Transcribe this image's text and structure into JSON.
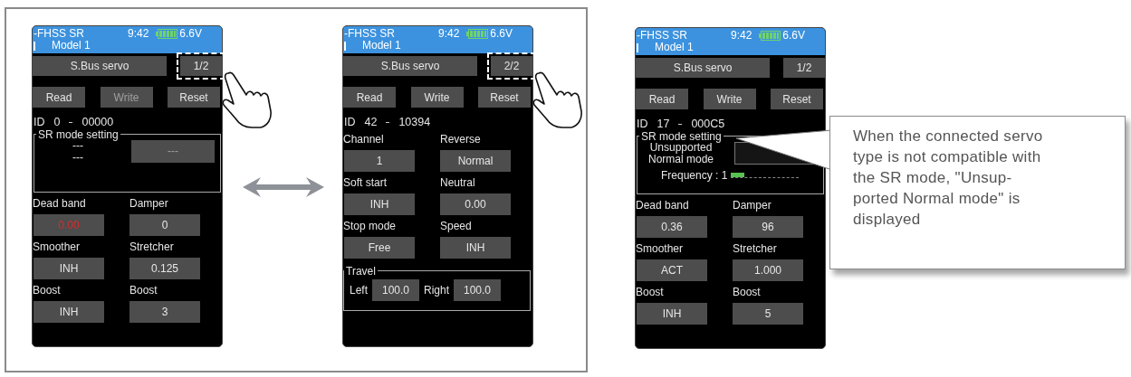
{
  "left_panel": {
    "screens": [
      {
        "header": {
          "system": "-FHSS SR",
          "time": "9:42",
          "voltage": "6.6V",
          "model": "Model 1"
        },
        "title_button": "S.Bus servo",
        "page_button": {
          "label": "1/2",
          "highlighted": true
        },
        "hand": true,
        "actions": [
          {
            "label": "Read",
            "disabled": false
          },
          {
            "label": "Write",
            "disabled": true
          },
          {
            "label": "Reset",
            "disabled": false
          }
        ],
        "id_line": {
          "label": "ID",
          "number": "0",
          "code": "00000"
        },
        "blocks": [
          {
            "kind": "group",
            "title": "SR mode setting",
            "lines": [
              "---",
              "---"
            ],
            "field": {
              "text": "---",
              "disabled": true
            }
          },
          {
            "kind": "params",
            "items": [
              {
                "label": "Dead band",
                "value": "0.00",
                "alert": true
              },
              {
                "label": "Damper",
                "value": "0",
                "alert": false
              }
            ]
          },
          {
            "kind": "params",
            "items": [
              {
                "label": "Smoother",
                "value": "INH",
                "alert": false
              },
              {
                "label": "Stretcher",
                "value": "0.125",
                "alert": false
              }
            ]
          },
          {
            "kind": "params",
            "items": [
              {
                "label": "Boost",
                "value": "INH",
                "alert": false
              },
              {
                "label": "Boost",
                "value": "3",
                "alert": false
              }
            ]
          }
        ]
      },
      {
        "header": {
          "system": "-FHSS SR",
          "time": "9:42",
          "voltage": "6.6V",
          "model": "Model 1"
        },
        "title_button": "S.Bus servo",
        "page_button": {
          "label": "2/2",
          "highlighted": true
        },
        "hand": true,
        "actions": [
          {
            "label": "Read",
            "disabled": false
          },
          {
            "label": "Write",
            "disabled": false
          },
          {
            "label": "Reset",
            "disabled": false
          }
        ],
        "id_line": {
          "label": "ID",
          "number": "42",
          "code": "10394"
        },
        "blocks": [
          {
            "kind": "params",
            "items": [
              {
                "label": "Channel",
                "value": "1",
                "alert": false
              },
              {
                "label": "Reverse",
                "value": "Normal",
                "alert": false
              }
            ]
          },
          {
            "kind": "params",
            "items": [
              {
                "label": "Soft start",
                "value": "INH",
                "alert": false
              },
              {
                "label": "Neutral",
                "value": "0.00",
                "alert": false
              }
            ]
          },
          {
            "kind": "params",
            "items": [
              {
                "label": "Stop mode",
                "value": "Free",
                "alert": false
              },
              {
                "label": "Speed",
                "value": "INH",
                "alert": false
              }
            ]
          },
          {
            "kind": "travel",
            "title": "Travel",
            "items": [
              {
                "label": "Left",
                "value": "100.0"
              },
              {
                "label": "Right",
                "value": "100.0"
              }
            ]
          }
        ]
      }
    ]
  },
  "right_panel": {
    "screens": [
      {
        "header": {
          "system": "-FHSS SR",
          "time": "9:42",
          "voltage": "6.6V",
          "model": "Model 1"
        },
        "title_button": "S.Bus servo",
        "page_button": {
          "label": "1/2",
          "highlighted": false
        },
        "hand": false,
        "actions": [
          {
            "label": "Read",
            "disabled": false
          },
          {
            "label": "Write",
            "disabled": false
          },
          {
            "label": "Reset",
            "disabled": false
          }
        ],
        "id_line": {
          "label": "ID",
          "number": "17",
          "code": "000C5"
        },
        "blocks": [
          {
            "kind": "group",
            "title": "SR mode setting",
            "lines": [
              "Unsupported",
              "Normal mode"
            ],
            "field": {
              "disabled": false
            },
            "frequency": {
              "label": "Frequency : 1",
              "level": 0.2
            }
          },
          {
            "kind": "params",
            "items": [
              {
                "label": "Dead band",
                "value": "0.36",
                "alert": false
              },
              {
                "label": "Damper",
                "value": "96",
                "alert": false
              }
            ]
          },
          {
            "kind": "params",
            "items": [
              {
                "label": "Smoother",
                "value": "ACT",
                "alert": false
              },
              {
                "label": "Stretcher",
                "value": "1.000",
                "alert": false
              }
            ]
          },
          {
            "kind": "params",
            "items": [
              {
                "label": "Boost",
                "value": "INH",
                "alert": false
              },
              {
                "label": "Boost",
                "value": "5",
                "alert": false
              }
            ]
          }
        ]
      }
    ],
    "callout": {
      "lines": [
        "When the connected servo",
        "type is not compatible with",
        "the SR mode, \"Unsup-",
        "ported Normal mode\" is",
        "displayed"
      ]
    }
  }
}
